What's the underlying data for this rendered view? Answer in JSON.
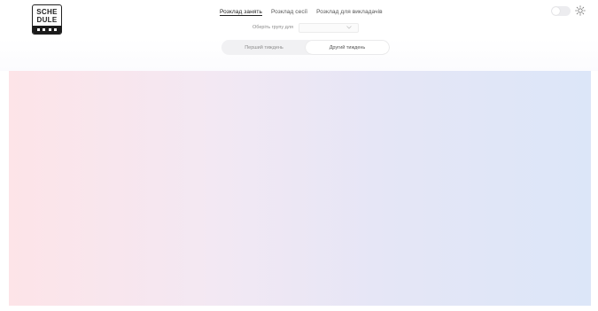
{
  "logo": {
    "line1": "SCHE",
    "line2": "DULE"
  },
  "nav": {
    "items": [
      {
        "label": "Розклад занять",
        "active": true
      },
      {
        "label": "Розклад сесії",
        "active": false
      },
      {
        "label": "Розклад для викладачів",
        "active": false
      }
    ]
  },
  "filter": {
    "label": "Оберіть групу для",
    "value": "",
    "chevron_icon": "chevron-down-icon"
  },
  "segmented": {
    "options": [
      {
        "label": "Перший тиждень",
        "active": false
      },
      {
        "label": "Другий тиждень",
        "active": true
      }
    ]
  },
  "theme": {
    "toggle_on": false,
    "icon": "sun-icon"
  },
  "colors": {
    "accent_text": "#222222",
    "muted_text": "#8e8e8e",
    "gradient_left": "#fde4e8",
    "gradient_right": "#dce6f8"
  }
}
